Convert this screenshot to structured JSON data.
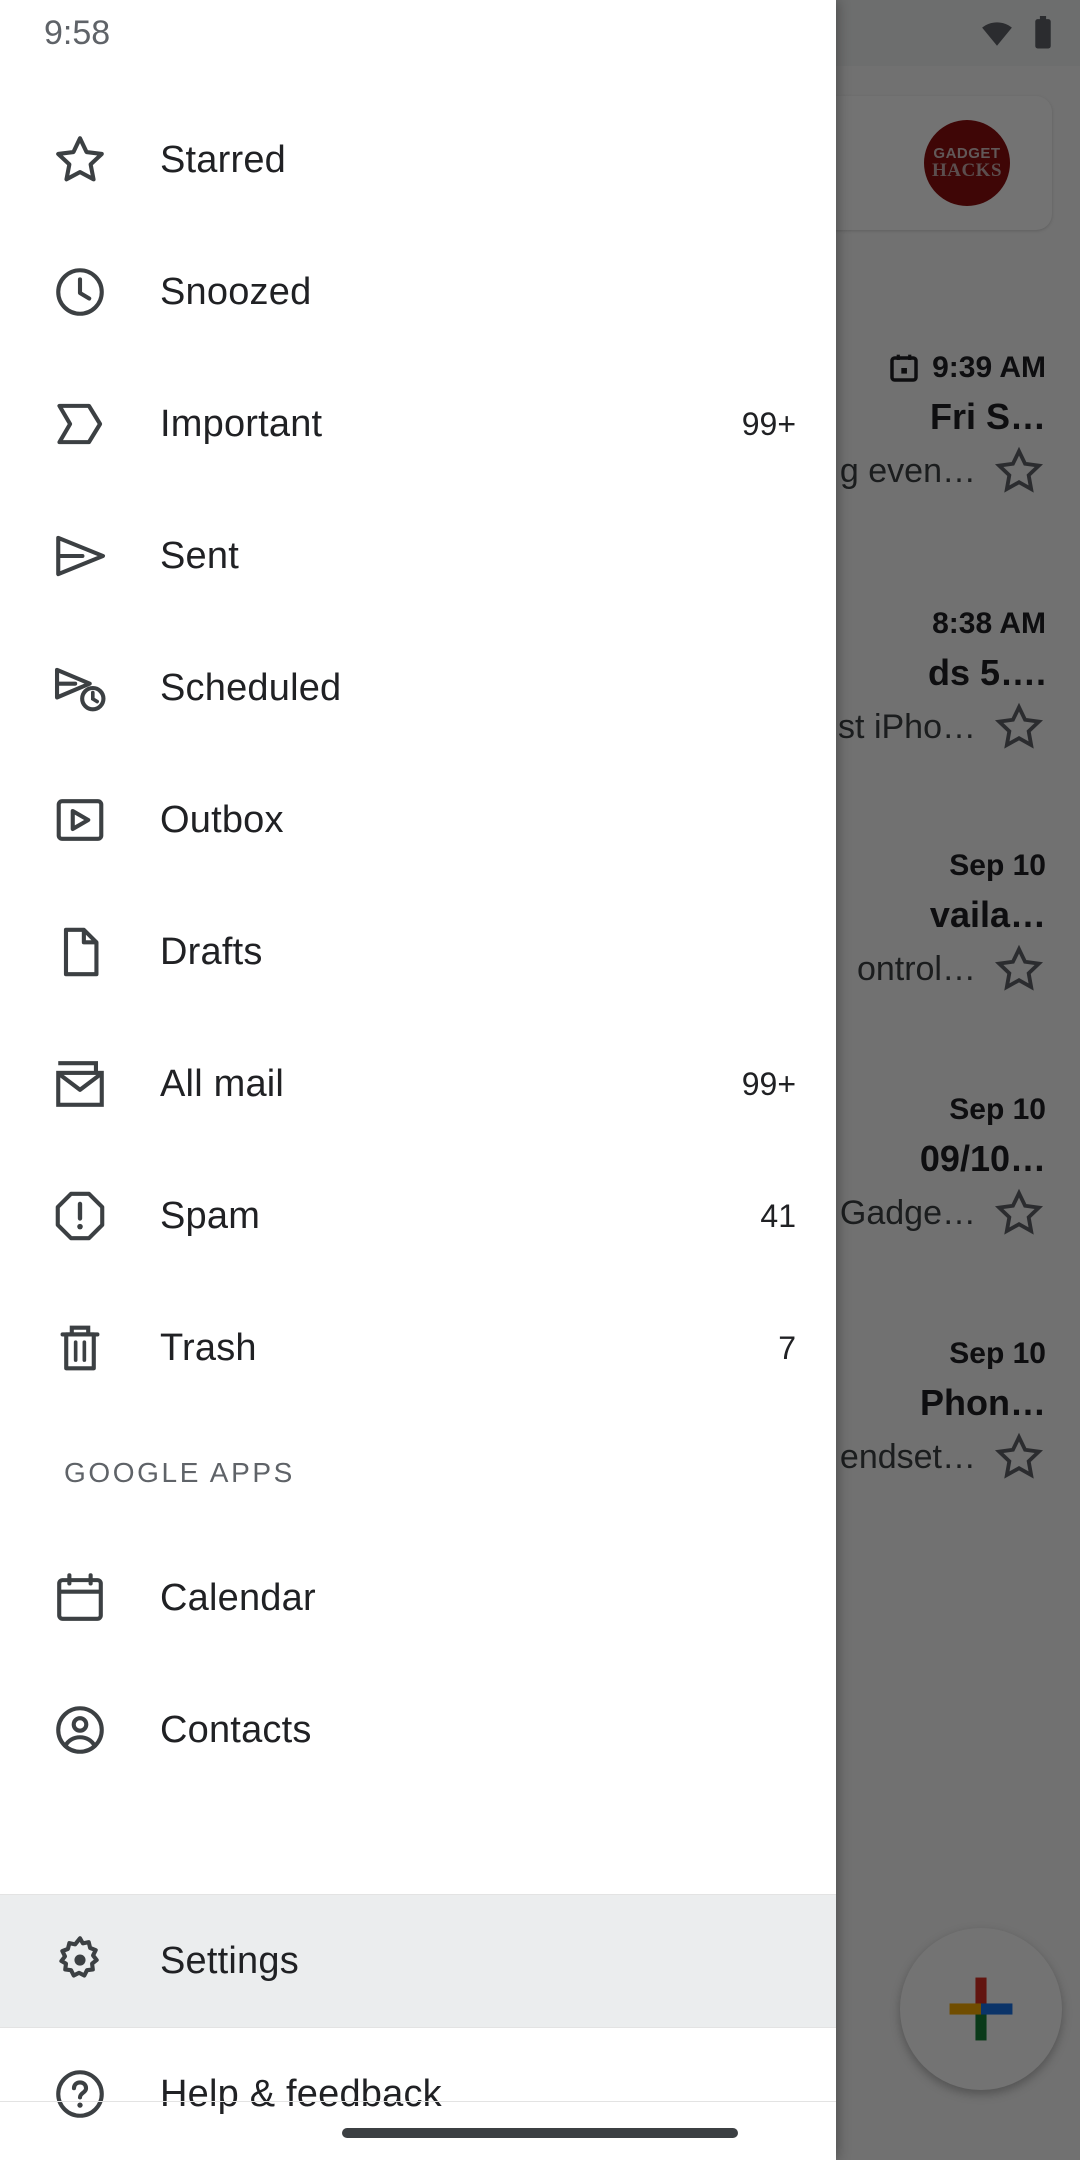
{
  "status_bar": {
    "time": "9:58",
    "wifi_icon": "wifi-icon",
    "battery_icon": "battery-icon"
  },
  "colors": {
    "drawer_bg": "#ffffff",
    "selected_row_bg": "#ebedee",
    "icon": "#3c4043",
    "label": "#202124",
    "section_label": "#5f6368",
    "avatar_bg": "#8d0f0f",
    "scrim": "rgba(0,0,0,0.55)",
    "google_red": "#d93025",
    "google_blue": "#1a73e8",
    "google_green": "#188038",
    "google_yellow": "#f9ab00"
  },
  "drawer": {
    "primary_items": [
      {
        "label": "Starred",
        "icon": "star-icon",
        "count": ""
      },
      {
        "label": "Snoozed",
        "icon": "clock-icon",
        "count": ""
      },
      {
        "label": "Important",
        "icon": "important-icon",
        "count": "99+"
      },
      {
        "label": "Sent",
        "icon": "send-icon",
        "count": ""
      },
      {
        "label": "Scheduled",
        "icon": "scheduled-icon",
        "count": ""
      },
      {
        "label": "Outbox",
        "icon": "outbox-icon",
        "count": ""
      },
      {
        "label": "Drafts",
        "icon": "draft-icon",
        "count": ""
      },
      {
        "label": "All mail",
        "icon": "all-mail-icon",
        "count": "99+"
      },
      {
        "label": "Spam",
        "icon": "spam-icon",
        "count": "41"
      },
      {
        "label": "Trash",
        "icon": "trash-icon",
        "count": "7"
      }
    ],
    "google_apps_header": "GOOGLE APPS",
    "google_apps_items": [
      {
        "label": "Calendar",
        "icon": "calendar-icon"
      },
      {
        "label": "Contacts",
        "icon": "contacts-icon"
      }
    ],
    "bottom_items": [
      {
        "label": "Settings",
        "icon": "gear-icon",
        "selected": true
      },
      {
        "label": "Help & feedback",
        "icon": "help-icon",
        "selected": false
      }
    ]
  },
  "background": {
    "search_avatar": {
      "line1": "GADGET",
      "line2": "HACKS"
    },
    "compose_fab_icon": "google-plus-icon",
    "emails": [
      {
        "time": "9:39 AM",
        "has_calendar_chip": true,
        "subject": "Fri S…",
        "snippet": "g even…",
        "star_icon": "star-outline-icon"
      },
      {
        "time": "8:38 AM",
        "has_calendar_chip": false,
        "subject": "ds 5….",
        "snippet": "st iPho…",
        "star_icon": "star-outline-icon"
      },
      {
        "time": "Sep 10",
        "has_calendar_chip": false,
        "subject": "vaila…",
        "snippet": "ontrol…",
        "star_icon": "star-outline-icon"
      },
      {
        "time": "Sep 10",
        "has_calendar_chip": false,
        "subject": "09/10…",
        "snippet": "Gadge…",
        "star_icon": "star-outline-icon"
      },
      {
        "time": "Sep 10",
        "has_calendar_chip": false,
        "subject": "Phon…",
        "snippet": "endset…",
        "star_icon": "star-outline-icon"
      }
    ]
  },
  "system_nav": {
    "gesture_pill": "home-gesture-pill"
  }
}
